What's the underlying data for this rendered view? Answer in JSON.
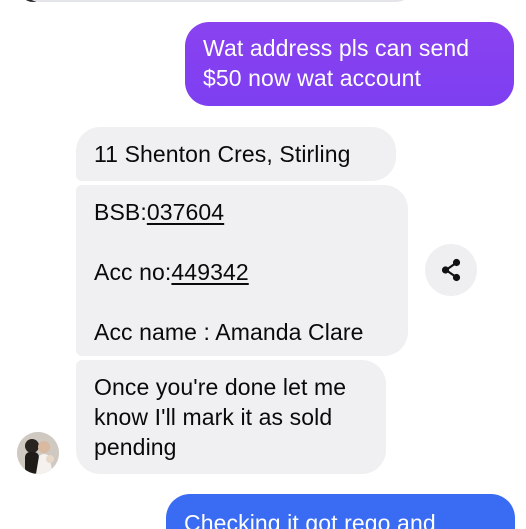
{
  "conversation": {
    "messages": [
      {
        "sender": "me",
        "lines": [
          "Wat address pls can send",
          "$50 now wat account"
        ]
      },
      {
        "sender": "them",
        "text": "11 Shenton Cres, Stirling"
      },
      {
        "sender": "them",
        "bsb_label": "BSB:",
        "bsb_value": "037604",
        "acc_no_label": "Acc no:",
        "acc_no_value": "449342",
        "acc_name_text": "Acc name : Amanda Clare"
      },
      {
        "sender": "them",
        "lines": [
          "Once you're done let me",
          "know I'll mark it as sold",
          "pending"
        ]
      },
      {
        "sender": "me",
        "text": "Checking it got rego and"
      }
    ],
    "share_icon": "share-icon",
    "avatar_icon": "contact-avatar"
  },
  "colors": {
    "outgoing_purple": "#8a42f0",
    "outgoing_blue": "#3a6cf3",
    "incoming_bg": "#f0f0f2",
    "text_dark": "#0a0a0a"
  }
}
